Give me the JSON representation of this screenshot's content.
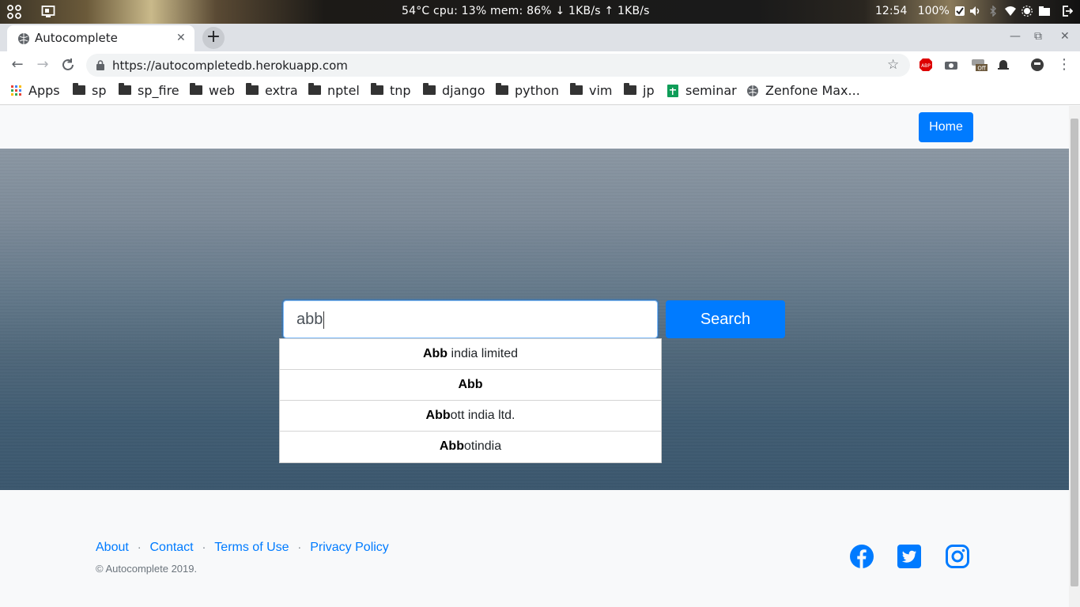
{
  "system_bar": {
    "status": "54°C  cpu: 13% mem: 86%  ↓  1KB/s ↑  1KB/s",
    "time": "12:54",
    "battery": "100%"
  },
  "tab": {
    "title": "Autocomplete",
    "close": "✕",
    "new_tab": "+"
  },
  "window_controls": {
    "minimize": "—",
    "restore": "⧉",
    "close": "✕"
  },
  "address_bar": {
    "url": "https://autocompletedb.herokuapp.com"
  },
  "bookmarks": [
    {
      "label": "Apps",
      "icon": "apps-grid-icon"
    },
    {
      "label": "sp",
      "icon": "folder-icon"
    },
    {
      "label": "sp_fire",
      "icon": "folder-icon"
    },
    {
      "label": "web",
      "icon": "folder-icon"
    },
    {
      "label": "extra",
      "icon": "folder-icon"
    },
    {
      "label": "nptel",
      "icon": "folder-icon"
    },
    {
      "label": "tnp",
      "icon": "folder-icon"
    },
    {
      "label": "django",
      "icon": "folder-icon"
    },
    {
      "label": "python",
      "icon": "folder-icon"
    },
    {
      "label": "vim",
      "icon": "folder-icon"
    },
    {
      "label": "jp",
      "icon": "folder-icon"
    },
    {
      "label": "seminar",
      "icon": "sheets-icon"
    },
    {
      "label": "Zenfone Max...",
      "icon": "globe-icon"
    }
  ],
  "navbar": {
    "home_label": "Home"
  },
  "search": {
    "query": "abb",
    "button_label": "Search",
    "suggestions": [
      {
        "match": "Abb",
        "rest": " india limited"
      },
      {
        "match": "Abb",
        "rest": ""
      },
      {
        "match": "Abb",
        "rest": "ott india ltd."
      },
      {
        "match": "Abb",
        "rest": "otindia"
      }
    ]
  },
  "footer": {
    "links": [
      "About",
      "Contact",
      "Terms of Use",
      "Privacy Policy"
    ],
    "separator": "·",
    "copyright": "© Autocomplete 2019.",
    "social": [
      "facebook-icon",
      "twitter-icon",
      "instagram-icon"
    ]
  },
  "colors": {
    "accent": "#007bff",
    "text": "#212529",
    "muted": "#6c757d"
  }
}
